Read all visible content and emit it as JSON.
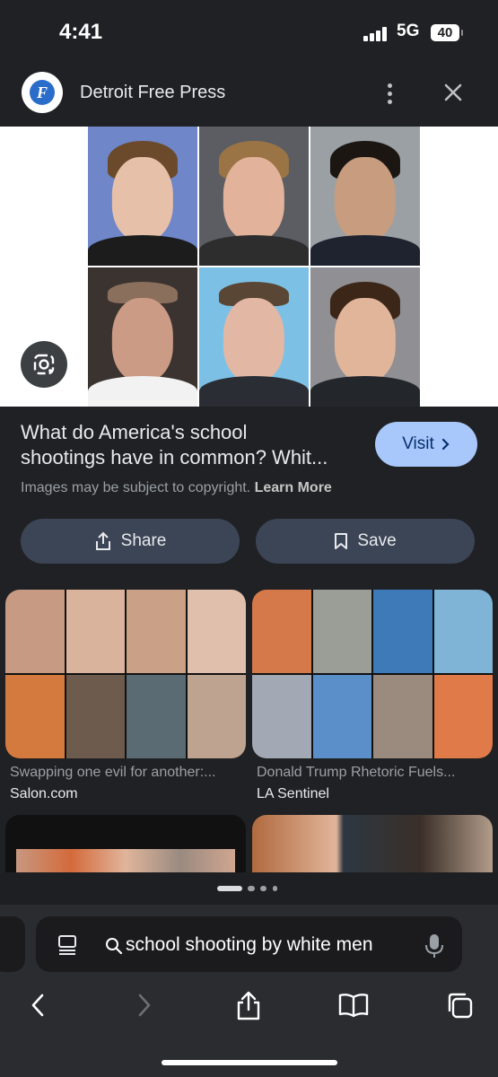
{
  "status": {
    "time": "4:41",
    "network": "5G",
    "battery": "40"
  },
  "header": {
    "site_name": "Detroit Free Press",
    "logo_text": "F"
  },
  "image": {
    "title_line1": "What do America's school",
    "title_line2": "shootings have in common? Whit...",
    "visit_label": "Visit",
    "copyright_text": "Images may be subject to copyright.",
    "learn_more": "Learn More"
  },
  "actions": {
    "share_label": "Share",
    "save_label": "Save"
  },
  "related": [
    {
      "title": "Swapping one evil for another:...",
      "source": "Salon.com"
    },
    {
      "title": "Donald Trump Rhetoric Fuels...",
      "source": "LA Sentinel"
    }
  ],
  "search": {
    "query": "school shooting by white men"
  },
  "colors": {
    "background": "#202124",
    "visit_button": "#a8c7fa",
    "pill_button": "#3c4556",
    "url_bar": "#1b1b1d"
  },
  "icons": [
    "lens-icon",
    "share-icon",
    "bookmark-icon",
    "more-vert-icon",
    "close-icon",
    "search-icon",
    "mic-icon",
    "back-icon",
    "forward-icon",
    "upload-icon",
    "book-icon",
    "tabs-icon",
    "reader-icon"
  ]
}
